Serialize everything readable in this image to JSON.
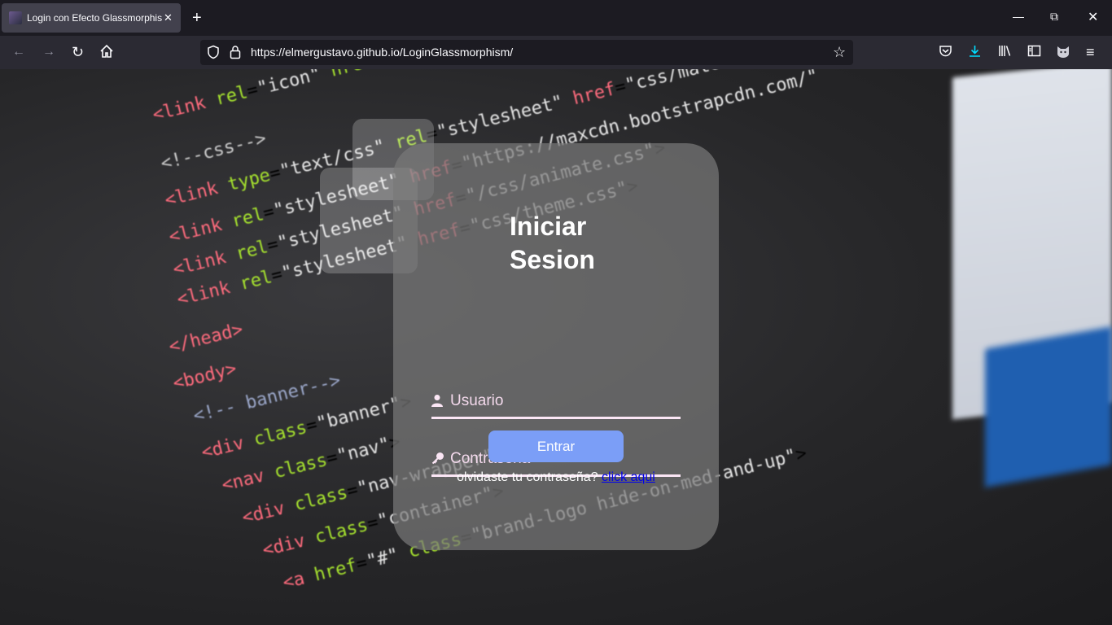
{
  "browser": {
    "tab_title": "Login con Efecto Glassmorphism",
    "new_tab_icon": "+",
    "url": "https://elmergustavo.github.io/LoginGlassmorphism/"
  },
  "login": {
    "title_line1": "Iniciar",
    "title_line2": "Sesion",
    "username_placeholder": "Usuario",
    "password_placeholder": "Contraseña",
    "submit_label": "Entrar",
    "forgot_text": "olvidaste tu contraseña?",
    "forgot_link": "click aqui"
  },
  "colors": {
    "button": "#7b9ef7",
    "underline": "#fbe6f5",
    "link": "#0000ee"
  }
}
